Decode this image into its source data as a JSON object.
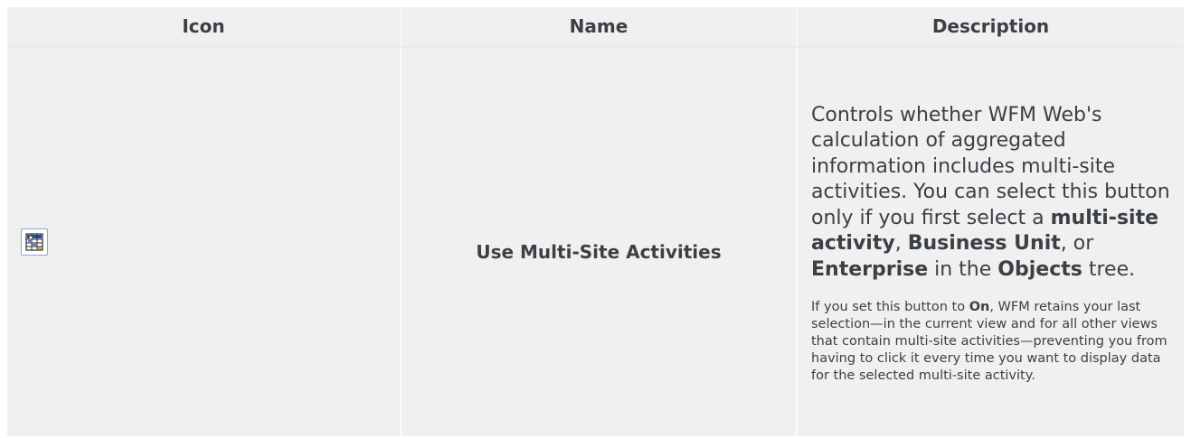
{
  "table": {
    "headers": [
      "Icon",
      "Name",
      "Description"
    ],
    "row": {
      "icon": "multi-site-activities-icon",
      "name": "Use Multi-Site Activities",
      "description": {
        "p1_a": "Controls whether WFM Web's calculation of aggregated information includes multi-site activities. You can select this button only if you first select a ",
        "p1_b1": "multi-site activity",
        "p1_c": ", ",
        "p1_b2": "Business Unit",
        "p1_d": ", or ",
        "p1_b3": "Enterprise",
        "p1_e": " in the ",
        "p1_b4": "Objects",
        "p1_f": " tree.",
        "p2_a": "If you set this button to ",
        "p2_b": "On",
        "p2_c": ",  WFM retains your last selection—in the current view and for all other views that contain multi-site activities—preventing you from having to click it every time you want to display data for the selected multi-site activity."
      }
    }
  }
}
